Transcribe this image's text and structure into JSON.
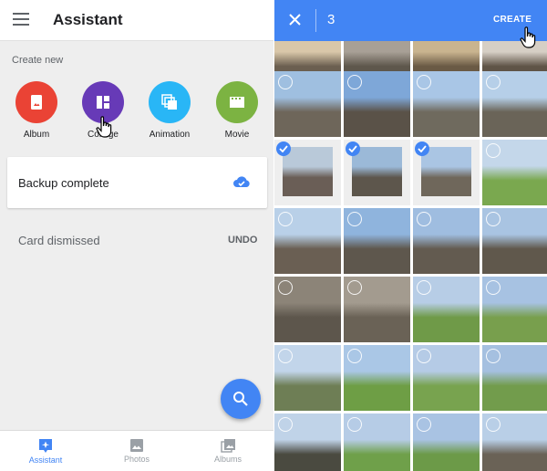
{
  "assistant": {
    "title": "Assistant",
    "create_new_label": "Create new",
    "create_items": [
      {
        "label": "Album",
        "color": "#ea4335",
        "icon": "album-icon"
      },
      {
        "label": "Collage",
        "color": "#673ab7",
        "icon": "collage-icon"
      },
      {
        "label": "Animation",
        "color": "#29b6f6",
        "icon": "animation-icon"
      },
      {
        "label": "Movie",
        "color": "#7cb342",
        "icon": "movie-icon"
      }
    ],
    "card_text": "Backup complete",
    "dismissed_text": "Card dismissed",
    "undo_label": "UNDO",
    "nav": [
      {
        "label": "Assistant",
        "icon": "assistant-icon",
        "active": true
      },
      {
        "label": "Photos",
        "icon": "photos-icon",
        "active": false
      },
      {
        "label": "Albums",
        "icon": "albums-icon",
        "active": false
      }
    ]
  },
  "selection": {
    "count": "3",
    "create_label": "CREATE"
  },
  "photos": [
    {
      "sky": "#d9c7a9",
      "ground": "#6b5f50",
      "selected": false
    },
    {
      "sky": "#a8a096",
      "ground": "#5e574c",
      "selected": false
    },
    {
      "sky": "#c9b48f",
      "ground": "#6a5a45",
      "selected": false
    },
    {
      "sky": "#d6cfc5",
      "ground": "#5f5447",
      "selected": false
    },
    {
      "sky": "#9fbfe0",
      "ground": "#6e665a",
      "selected": false
    },
    {
      "sky": "#7ea7d8",
      "ground": "#5a5248",
      "selected": false
    },
    {
      "sky": "#a9c6e6",
      "ground": "#6f6a5e",
      "selected": false
    },
    {
      "sky": "#b6cfe8",
      "ground": "#6a6458",
      "selected": false
    },
    {
      "sky": "#b9c9d9",
      "ground": "#6a5e56",
      "selected": true
    },
    {
      "sky": "#9bb9d8",
      "ground": "#5d564c",
      "selected": true
    },
    {
      "sky": "#aac5e3",
      "ground": "#6f675b",
      "selected": true
    },
    {
      "sky": "#c4d7ea",
      "ground": "#7aa84f",
      "selected": false
    },
    {
      "sky": "#b9d0e8",
      "ground": "#6a5f53",
      "selected": false
    },
    {
      "sky": "#8fb4dd",
      "ground": "#5e574d",
      "selected": false
    },
    {
      "sky": "#9fbde0",
      "ground": "#635b50",
      "selected": false
    },
    {
      "sky": "#a9c4e2",
      "ground": "#60584c",
      "selected": false
    },
    {
      "sky": "#8c8478",
      "ground": "#5d564c",
      "selected": false
    },
    {
      "sky": "#a39b8f",
      "ground": "#6a6256",
      "selected": false
    },
    {
      "sky": "#b7cde6",
      "ground": "#6f9a48",
      "selected": false
    },
    {
      "sky": "#a7c2e2",
      "ground": "#789f4d",
      "selected": false
    },
    {
      "sky": "#c2d5ea",
      "ground": "#6e7e55",
      "selected": false
    },
    {
      "sky": "#aac7e6",
      "ground": "#6e9e45",
      "selected": false
    },
    {
      "sky": "#b5cbe6",
      "ground": "#78a34f",
      "selected": false
    },
    {
      "sky": "#a5c0e0",
      "ground": "#729c4c",
      "selected": false
    },
    {
      "sky": "#c0d3e8",
      "ground": "#4a4a40",
      "selected": false
    },
    {
      "sky": "#b6cce6",
      "ground": "#6fa04a",
      "selected": false
    },
    {
      "sky": "#a9c3e3",
      "ground": "#6c9a48",
      "selected": false
    },
    {
      "sky": "#b9cfe7",
      "ground": "#6a6256",
      "selected": false
    }
  ]
}
